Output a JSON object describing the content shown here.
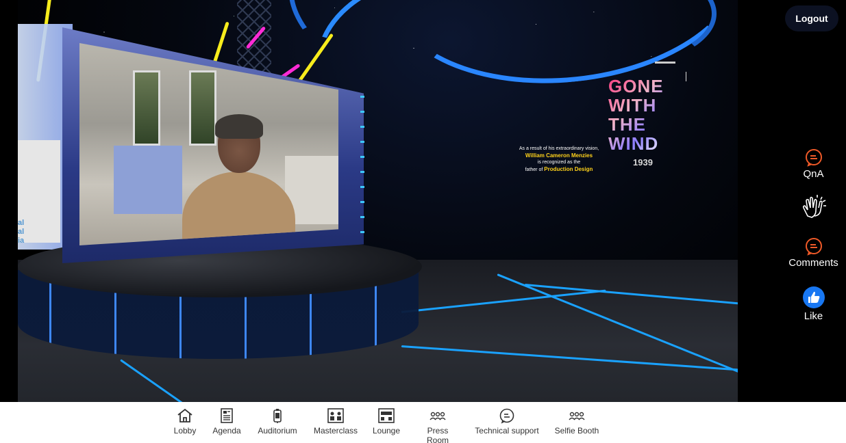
{
  "header": {
    "logout_label": "Logout"
  },
  "stage": {
    "poster_title": [
      "GONE",
      "WITH",
      "THE",
      "WIND"
    ],
    "poster_year": "1939",
    "poster_quote_line1": "As a result of his extraordinary vision,",
    "poster_quote_name": "William Cameron Menzies",
    "poster_quote_line2": "is recognized as the",
    "poster_quote_line3": "father of",
    "poster_quote_role": "Production Design",
    "side_panel_text": [
      "al",
      "al",
      "ia"
    ]
  },
  "side_tools": {
    "qna_label": "QnA",
    "comments_label": "Comments",
    "like_label": "Like",
    "accent_color": "#f05a28",
    "like_color": "#1877f2"
  },
  "nav": {
    "items": [
      {
        "label": "Lobby",
        "icon": "home-icon"
      },
      {
        "label": "Agenda",
        "icon": "document-icon"
      },
      {
        "label": "Auditorium",
        "icon": "microphone-icon"
      },
      {
        "label": "Masterclass",
        "icon": "classroom-icon"
      },
      {
        "label": "Lounge",
        "icon": "lounge-icon"
      },
      {
        "label": "Press Room",
        "icon": "people-icon"
      },
      {
        "label": "Technical support",
        "icon": "chat-icon"
      },
      {
        "label": "Selfie Booth",
        "icon": "people-icon"
      }
    ]
  }
}
